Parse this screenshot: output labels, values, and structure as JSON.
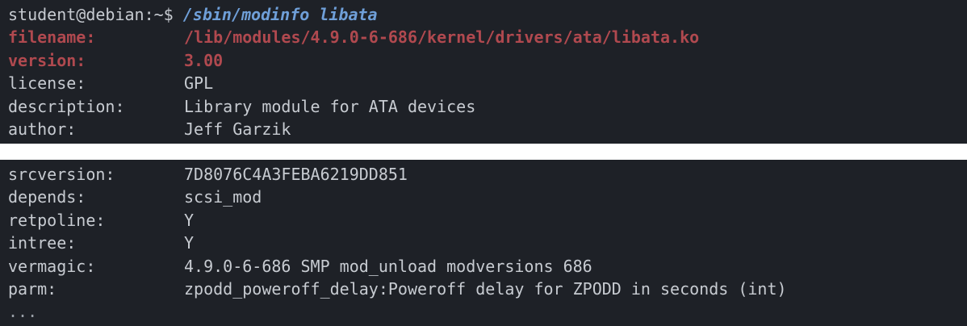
{
  "terminal_top": {
    "prompt": "student@debian:~$ ",
    "command": "/sbin/modinfo libata",
    "rows": [
      {
        "key": "filename:",
        "value": "/lib/modules/4.9.0-6-686/kernel/drivers/ata/libata.ko"
      },
      {
        "key": "version:",
        "value": "3.00"
      },
      {
        "key": "license:",
        "value": "GPL"
      },
      {
        "key": "description:",
        "value": "Library module for ATA devices"
      },
      {
        "key": "author:",
        "value": "Jeff Garzik"
      }
    ]
  },
  "terminal_bottom": {
    "rows": [
      {
        "key": "srcversion:",
        "value": "7D8076C4A3FEBA6219DD851"
      },
      {
        "key": "depends:",
        "value": "scsi_mod"
      },
      {
        "key": "retpoline:",
        "value": "Y"
      },
      {
        "key": "intree:",
        "value": "Y"
      },
      {
        "key": "vermagic:",
        "value": "4.9.0-6-686 SMP mod_unload modversions 686"
      },
      {
        "key": "parm:",
        "value": "zpodd_poweroff_delay:Poweroff delay for ZPODD in seconds (int)"
      }
    ],
    "ellipsis": "..."
  },
  "colors": {
    "background": "#1e2127",
    "text": "#c7cbd1",
    "command": "#6f9fd8",
    "highlight": "#b0494f"
  }
}
